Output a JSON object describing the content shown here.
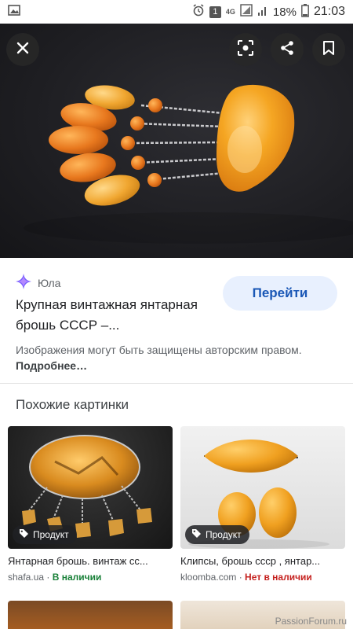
{
  "status_bar": {
    "battery_percent": "18%",
    "time": "21:03",
    "notification_count": "1",
    "network": "4G"
  },
  "hero": {
    "icons": [
      "close-icon",
      "lens-icon",
      "share-icon",
      "bookmark-icon"
    ]
  },
  "result": {
    "source": "Юла",
    "title": "Крупная винтажная янтарная брошь СССР –...",
    "go_button": "Перейти",
    "copyright_text": "Изображения могут быть защищены авторским правом.",
    "copyright_more": "Подробнее…"
  },
  "similar": {
    "title": "Похожие картинки",
    "items": [
      {
        "badge": "Продукт",
        "title": "Янтарная брошь. винтаж сс...",
        "site": "shafa.ua",
        "separator": " · ",
        "availability": "В наличии"
      },
      {
        "badge": "Продукт",
        "title": "Клипсы, брошь ссср , янтар...",
        "site": "kloomba.com",
        "separator": " · ",
        "availability": "Нет в наличии"
      }
    ]
  },
  "watermark": "PassionForum.ru",
  "colors": {
    "accent": "#1a57b6",
    "button_bg": "#e8f0fe",
    "in_stock": "#188038",
    "out_of_stock": "#c5221f"
  }
}
